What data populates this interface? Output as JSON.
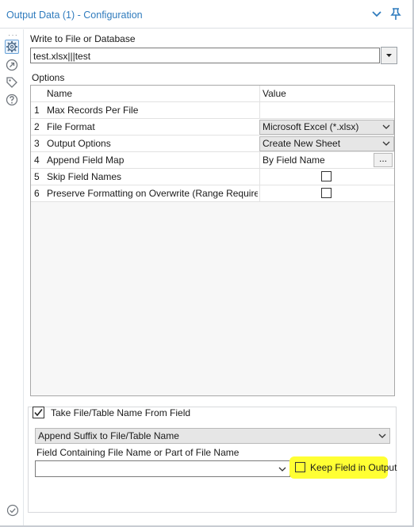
{
  "window": {
    "title": "Output Data (1) - Configuration"
  },
  "rail": {
    "dots": "···",
    "icons": [
      "gear-icon",
      "arrow-circle-icon",
      "tag-icon",
      "help-icon"
    ]
  },
  "write": {
    "label": "Write to File or Database",
    "value": "test.xlsx|||test"
  },
  "options": {
    "label": "Options",
    "header": {
      "name": "Name",
      "value": "Value"
    },
    "rows": [
      {
        "num": "1",
        "name": "Max Records Per File",
        "value": ""
      },
      {
        "num": "2",
        "name": "File Format",
        "value": "Microsoft Excel (*.xlsx)"
      },
      {
        "num": "3",
        "name": "Output Options",
        "value": "Create New Sheet"
      },
      {
        "num": "4",
        "name": "Append Field Map",
        "value": "By Field Name",
        "button": "..."
      },
      {
        "num": "5",
        "name": "Skip Field Names",
        "checked": false
      },
      {
        "num": "6",
        "name": "Preserve Formatting on Overwrite (Range Required)",
        "checked": false
      }
    ]
  },
  "take": {
    "label": "Take File/Table Name From Field",
    "checked": true,
    "mode": "Append Suffix to File/Table Name",
    "field_label": "Field Containing File Name or Part of File Name",
    "field_value": "",
    "keep_label": "Keep Field in Output",
    "keep_checked": false,
    "highlight_color": "#ffff33"
  },
  "colors": {
    "title": "#2f7bbd",
    "accent": "#6aa3d8"
  }
}
